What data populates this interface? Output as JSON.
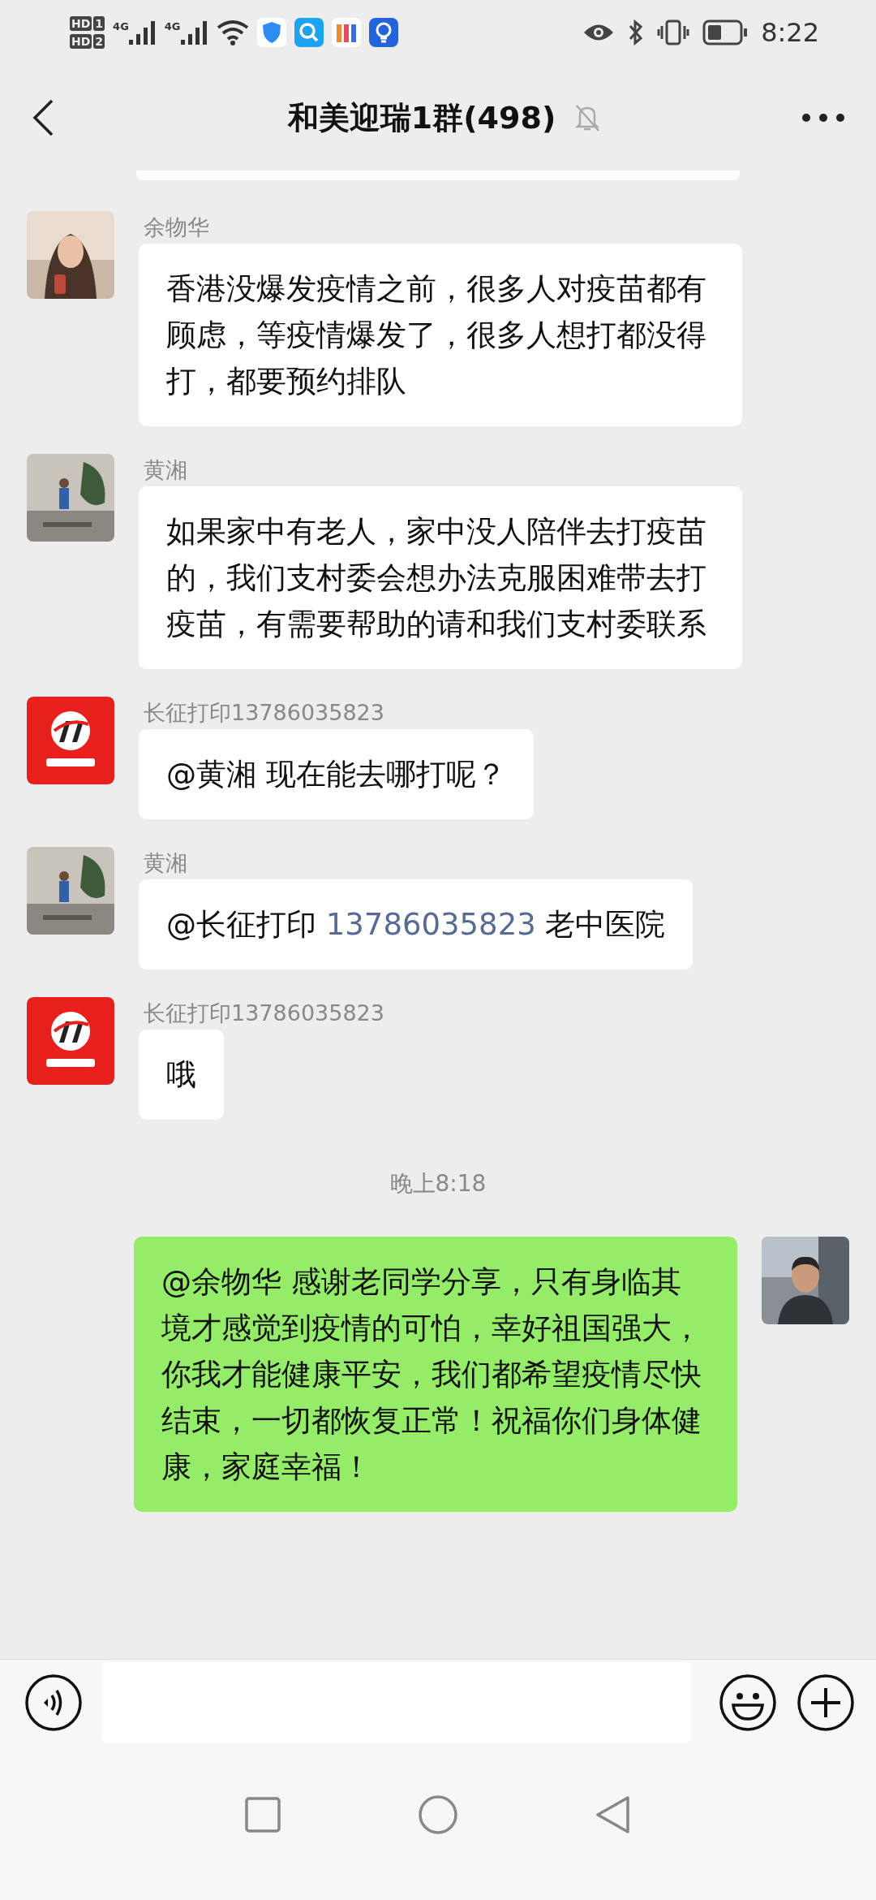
{
  "status_bar": {
    "sims": [
      {
        "badge": "HD",
        "slot": "1"
      },
      {
        "badge": "HD",
        "slot": "2"
      }
    ],
    "networks": [
      "4G",
      "4G"
    ],
    "time": "8:22"
  },
  "header": {
    "title": "和美迎瑞1群(498)",
    "muted": true
  },
  "messages": [
    {
      "kind": "incoming",
      "sender": "余物华",
      "parts": [
        {
          "kind": "text",
          "text": "香港没爆发疫情之前，很多人对疫苗都有顾虑，等疫情爆发了，很多人想打都没得打，都要预约排队"
        }
      ]
    },
    {
      "kind": "incoming",
      "sender": "黄湘",
      "parts": [
        {
          "kind": "text",
          "text": "如果家中有老人，家中没人陪伴去打疫苗的，我们支村委会想办法克服困难带去打疫苗，有需要帮助的请和我们支村委联系"
        }
      ]
    },
    {
      "kind": "incoming",
      "sender": "长征打印13786035823",
      "parts": [
        {
          "kind": "text",
          "text": "@黄湘  现在能去哪打呢？"
        }
      ]
    },
    {
      "kind": "incoming",
      "sender": "黄湘",
      "parts": [
        {
          "kind": "text",
          "text": "@长征打印 "
        },
        {
          "kind": "link",
          "text": "13786035823"
        },
        {
          "kind": "text",
          "text": " 老中医院"
        }
      ]
    },
    {
      "kind": "incoming",
      "sender": "长征打印13786035823",
      "parts": [
        {
          "kind": "text",
          "text": "哦"
        }
      ]
    },
    {
      "kind": "time",
      "text": "晚上8:18"
    },
    {
      "kind": "outgoing",
      "parts": [
        {
          "kind": "text",
          "text": "@余物华  感谢老同学分享，只有身临其境才感觉到疫情的可怕，幸好祖国强大，你我才能健康平安，我们都希望疫情尽快结束，一切都恢复正常！祝福你们身体健康，家庭幸福！"
        }
      ]
    }
  ]
}
